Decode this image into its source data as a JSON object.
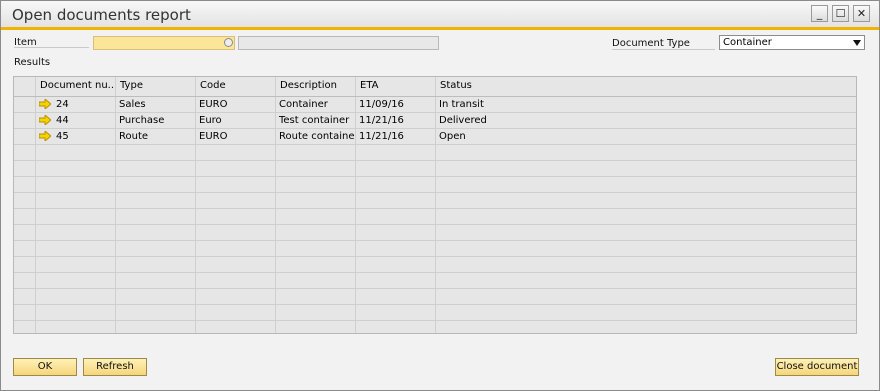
{
  "window": {
    "title": "Open documents report"
  },
  "controls": {
    "minimize": "_",
    "maximize": "☐",
    "close": "✕"
  },
  "form": {
    "item_label": "Item",
    "item_value": "",
    "item_desc_value": "",
    "doc_type_label": "Document Type",
    "doc_type_value": "Container",
    "results_label": "Results"
  },
  "table": {
    "headers": [
      "",
      "Document nu...",
      "Type",
      "Code",
      "Description",
      "ETA",
      "Status"
    ],
    "rows": [
      [
        "24",
        "Sales",
        "EURO",
        "Container",
        "11/09/16",
        "In transit"
      ],
      [
        "44",
        "Purchase",
        "Euro",
        "Test container",
        "11/21/16",
        "Delivered"
      ],
      [
        "45",
        "Route",
        "EURO",
        "Route container",
        "11/21/16",
        "Open"
      ]
    ],
    "empty_rows": 12
  },
  "buttons": {
    "ok": "OK",
    "refresh": "Refresh",
    "close_document": "Close document"
  },
  "colors": {
    "accent": "#f0b400",
    "field_yellow": "#fbe599",
    "button_yellow": "#f5d57a"
  }
}
